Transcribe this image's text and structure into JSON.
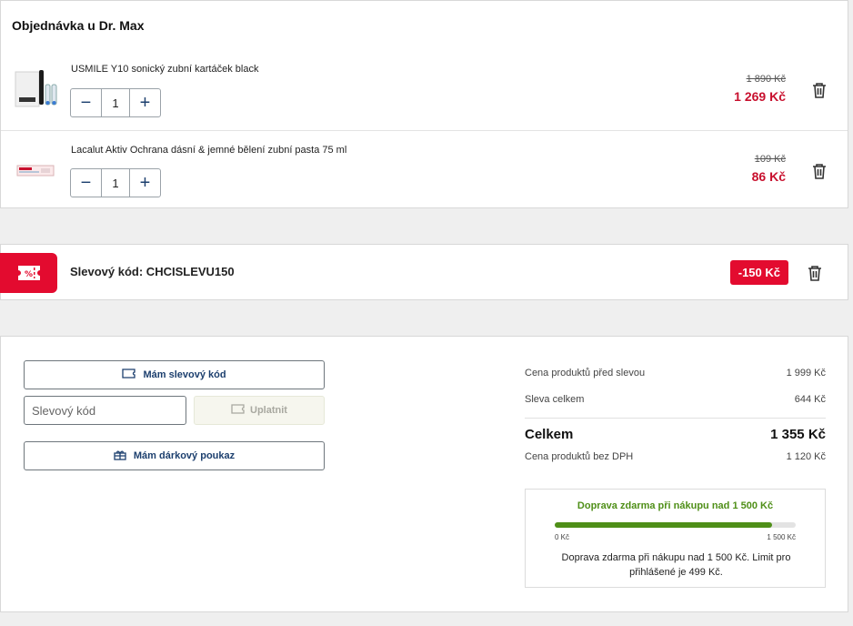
{
  "order": {
    "title": "Objednávka u Dr. Max",
    "items": [
      {
        "name": "USMILE Y10 sonický zubní kartáček black",
        "qty": "1",
        "old_price": "1 890 Kč",
        "new_price": "1 269 Kč",
        "thumb_icon": "toothbrush-product-image"
      },
      {
        "name": "Lacalut Aktiv Ochrana dásní & jemné bělení zubní pasta 75 ml",
        "qty": "1",
        "old_price": "109 Kč",
        "new_price": "86 Kč",
        "thumb_icon": "toothpaste-product-image"
      }
    ]
  },
  "coupon": {
    "label": "Slevový kód: CHCISLEVU150",
    "amount": "-150 Kč",
    "icon": "discount-ticket-icon"
  },
  "summary": {
    "have_code_label": "Mám slevový kód",
    "code_placeholder": "Slevový kód",
    "apply_label": "Uplatnit",
    "gift_label": "Mám dárkový poukaz",
    "rows": {
      "before_discount_label": "Cena produktů před slevou",
      "before_discount_value": "1 999 Kč",
      "discount_label": "Sleva celkem",
      "discount_value": "644 Kč",
      "total_label": "Celkem",
      "total_value": "1 355 Kč",
      "no_vat_label": "Cena produktů bez DPH",
      "no_vat_value": "1 120 Kč"
    },
    "shipping": {
      "title": "Doprava zdarma při nákupu nad 1 500 Kč",
      "progress": 0.903,
      "min_label": "0 Kč",
      "max_label": "1 500 Kč",
      "text": "Doprava zdarma při nákupu nad 1 500 Kč. Limit pro přihlášené je 499 Kč."
    }
  },
  "colors": {
    "accent_red": "#e30b2f",
    "price_red": "#c8102e",
    "navy": "#1c3f6e",
    "green": "#4f8f18"
  }
}
